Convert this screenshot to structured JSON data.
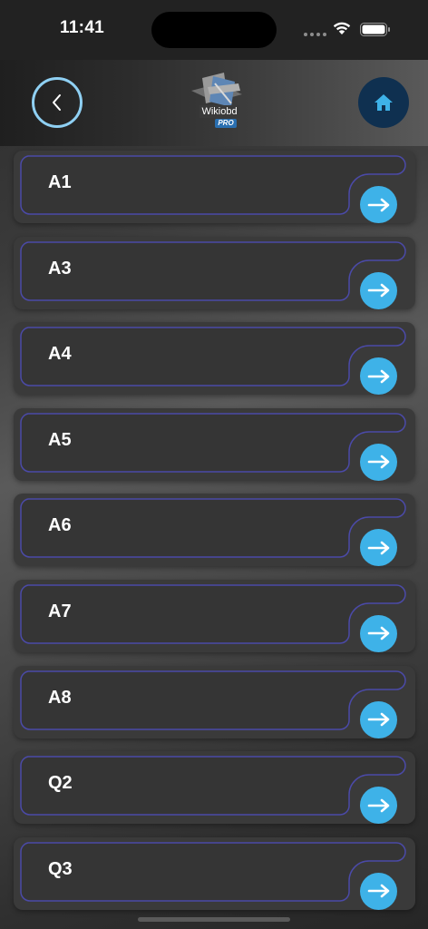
{
  "status_bar": {
    "time": "11:41"
  },
  "header": {
    "logo_text": "Wikiobd",
    "logo_badge": "PRO",
    "back_icon": "chevron-left-icon",
    "home_icon": "home-icon"
  },
  "colors": {
    "accent": "#3eb2e8",
    "back_ring": "#8fd0f3",
    "home_bg": "#0f3050",
    "card_bg": "#3a3a3a",
    "card_outline": "#4b4aa8"
  },
  "items": [
    {
      "label": "A1"
    },
    {
      "label": "A3"
    },
    {
      "label": "A4"
    },
    {
      "label": "A5"
    },
    {
      "label": "A6"
    },
    {
      "label": "A7"
    },
    {
      "label": "A8"
    },
    {
      "label": "Q2"
    },
    {
      "label": "Q3"
    }
  ]
}
